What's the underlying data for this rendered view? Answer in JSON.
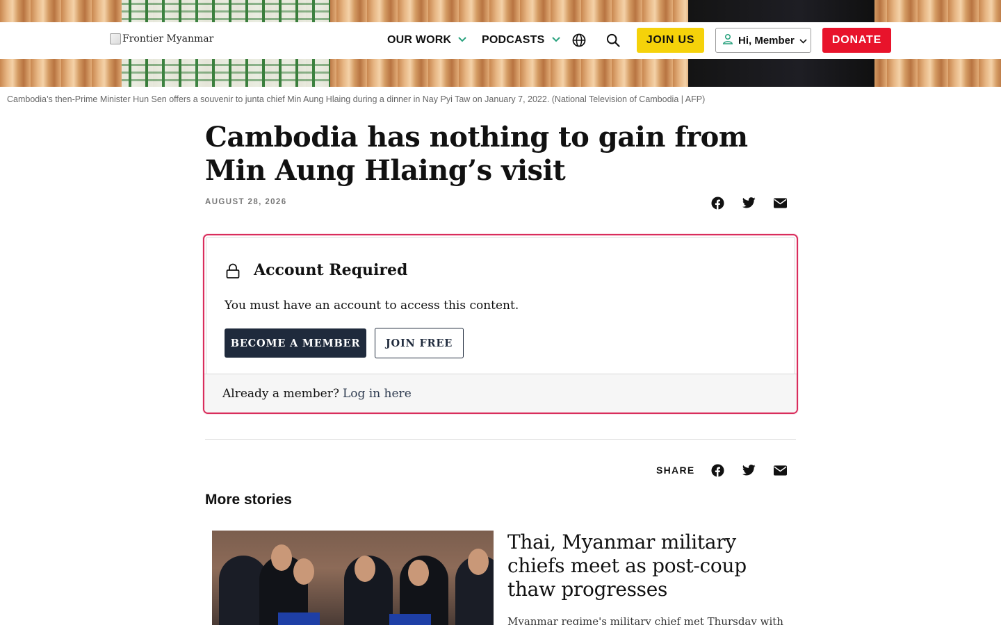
{
  "header": {
    "logo_alt": "Frontier Myanmar",
    "nav": [
      {
        "label": "OUR WORK"
      },
      {
        "label": "PODCASTS"
      }
    ],
    "join_us": "JOIN US",
    "member_greeting": "Hi, Member",
    "donate": "DONATE",
    "colors": {
      "join": "#f5d20a",
      "donate": "#e8132b",
      "accent": "#27a17d"
    }
  },
  "hero": {
    "caption": "Cambodia’s then-Prime Minister Hun Sen offers a souvenir to junta chief Min Aung Hlaing during a dinner in Nay Pyi Taw on January 7, 2022. (National Television of Cambodia | AFP)"
  },
  "article": {
    "title": "Cambodia has nothing to gain from Min Aung Hlaing’s visit",
    "date": "AUGUST 28, 2026"
  },
  "paywall": {
    "title": "Account Required",
    "message": "You must have an account to access this content.",
    "become_member": "BECOME A MEMBER",
    "join_free": "JOIN FREE",
    "already_member": "Already a member?",
    "login_link": "Log in here"
  },
  "share": {
    "label": "SHARE"
  },
  "more_stories": {
    "heading": "More stories",
    "items": [
      {
        "title": "Thai, Myanmar military chiefs meet as post-coup thaw progresses",
        "excerpt": "Myanmar regime's military chief met Thursday with"
      }
    ]
  }
}
